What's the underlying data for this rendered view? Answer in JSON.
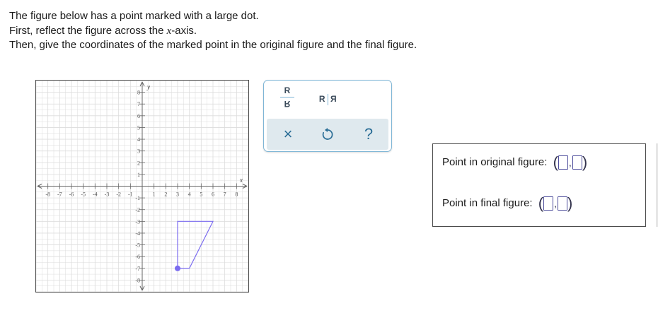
{
  "instructions": {
    "line1": "The figure below has a point marked with a large dot.",
    "line2_prefix": "First, reflect the figure across the ",
    "line2_var": "x",
    "line2_suffix": "-axis.",
    "line3": "Then, give the coordinates of the marked point in the original figure and the final figure."
  },
  "graph": {
    "x_axis_label": "x",
    "y_axis_label": "y",
    "x_ticks": [
      "-8",
      "-7",
      "-6",
      "-5",
      "-4",
      "-3",
      "-2",
      "-1",
      "1",
      "2",
      "3",
      "4",
      "5",
      "6",
      "7",
      "8"
    ],
    "y_ticks": [
      "8",
      "7",
      "6",
      "5",
      "4",
      "3",
      "2",
      "1",
      "-1",
      "-2",
      "-3",
      "-4",
      "-5",
      "-6",
      "-7",
      "-8"
    ],
    "range": {
      "x": [
        -9,
        9
      ],
      "y": [
        -9,
        9
      ]
    },
    "figure_vertices": [
      [
        3,
        -3
      ],
      [
        6,
        -3
      ],
      [
        4,
        -7
      ],
      [
        3,
        -7
      ]
    ],
    "marked_point": [
      3,
      -7
    ],
    "figure_color": "#7b6cf0",
    "grid_color": "#dcdcdc"
  },
  "toolbar": {
    "reflect_vertical": {
      "top": "R",
      "bottom": "R"
    },
    "reflect_horizontal": {
      "left": "R",
      "right": "R"
    },
    "clear_label": "×",
    "help_label": "?",
    "accent_color": "#2a6d96"
  },
  "answers": {
    "original_label": "Point in original figure:",
    "final_label": "Point in final figure:",
    "open_paren": "(",
    "close_paren": ")",
    "comma": ","
  }
}
